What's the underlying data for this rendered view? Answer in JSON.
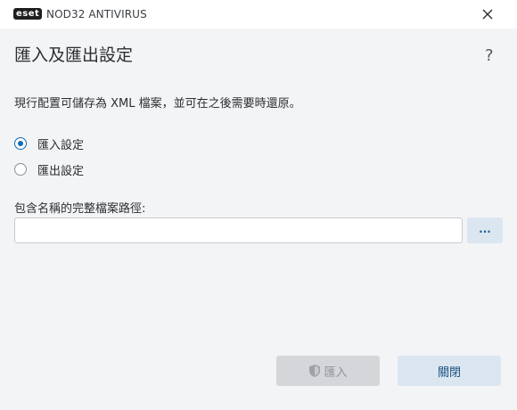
{
  "window": {
    "brand_logo": "eset",
    "app_title": "NOD32 ANTIVIRUS",
    "close_icon": "close-icon"
  },
  "dialog": {
    "title": "匯入及匯出設定",
    "help_label": "?",
    "description": "現行配置可儲存為 XML 檔案，並可在之後需要時還原。",
    "options": [
      {
        "label": "匯入設定",
        "checked": true
      },
      {
        "label": "匯出設定",
        "checked": false
      }
    ],
    "path_label": "包含名稱的完整檔案路徑:",
    "path_value": "",
    "browse_label": "...",
    "import_button": "匯入",
    "import_icon": "shield-icon",
    "close_button": "關閉"
  },
  "colors": {
    "accent": "#0f6db7",
    "background": "#f3f4f6",
    "secondary_button": "#dbe6f1",
    "disabled_button": "#d4d6d9"
  }
}
